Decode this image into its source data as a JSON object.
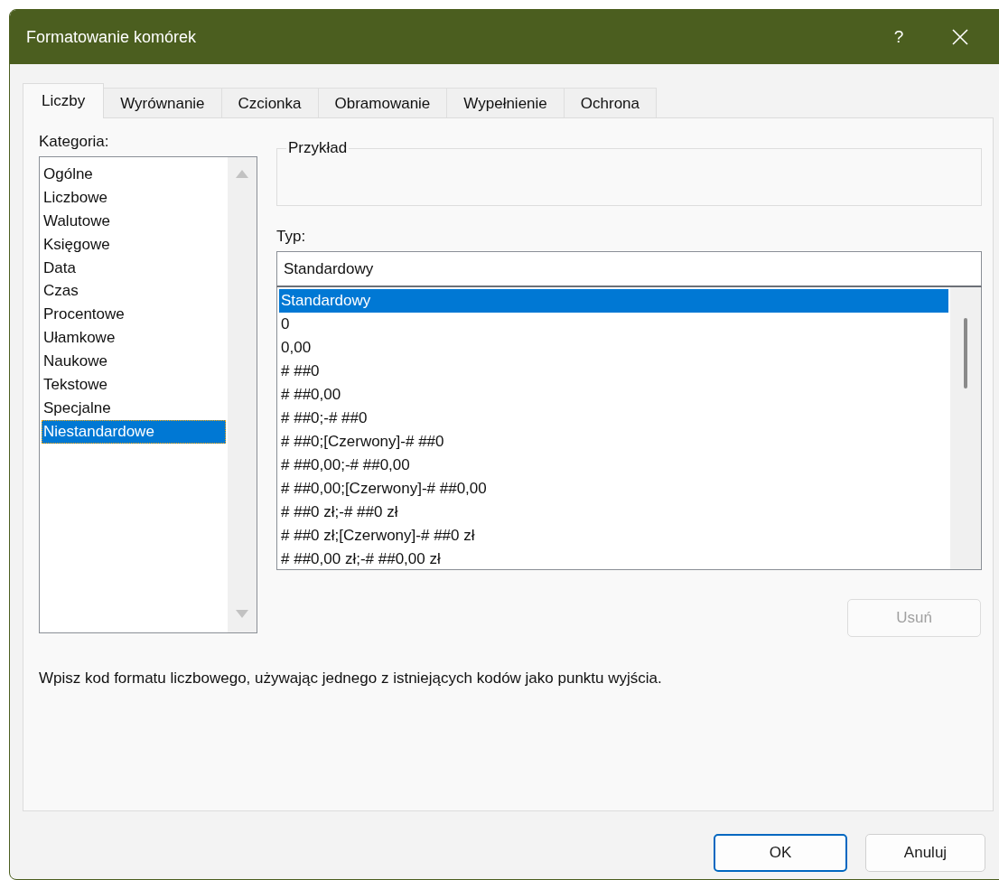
{
  "window": {
    "title": "Formatowanie komórek",
    "help_button": "?"
  },
  "tabs": [
    {
      "label": "Liczby",
      "selected": true
    },
    {
      "label": "Wyrównanie",
      "selected": false
    },
    {
      "label": "Czcionka",
      "selected": false
    },
    {
      "label": "Obramowanie",
      "selected": false
    },
    {
      "label": "Wypełnienie",
      "selected": false
    },
    {
      "label": "Ochrona",
      "selected": false
    }
  ],
  "category": {
    "label": "Kategoria:",
    "items": [
      {
        "label": "Ogólne",
        "selected": false
      },
      {
        "label": "Liczbowe",
        "selected": false
      },
      {
        "label": "Walutowe",
        "selected": false
      },
      {
        "label": "Księgowe",
        "selected": false
      },
      {
        "label": "Data",
        "selected": false
      },
      {
        "label": "Czas",
        "selected": false
      },
      {
        "label": "Procentowe",
        "selected": false
      },
      {
        "label": "Ułamkowe",
        "selected": false
      },
      {
        "label": "Naukowe",
        "selected": false
      },
      {
        "label": "Tekstowe",
        "selected": false
      },
      {
        "label": "Specjalne",
        "selected": false
      },
      {
        "label": "Niestandardowe",
        "selected": true
      }
    ]
  },
  "sample": {
    "label": "Przykład"
  },
  "type": {
    "label": "Typ:",
    "value": "Standardowy",
    "items": [
      {
        "label": "Standardowy",
        "selected": true
      },
      {
        "label": "0",
        "selected": false
      },
      {
        "label": "0,00",
        "selected": false
      },
      {
        "label": "# ##0",
        "selected": false
      },
      {
        "label": "# ##0,00",
        "selected": false
      },
      {
        "label": "# ##0;-# ##0",
        "selected": false
      },
      {
        "label": "# ##0;[Czerwony]-# ##0",
        "selected": false
      },
      {
        "label": "# ##0,00;-# ##0,00",
        "selected": false
      },
      {
        "label": "# ##0,00;[Czerwony]-# ##0,00",
        "selected": false
      },
      {
        "label": "# ##0 zł;-# ##0 zł",
        "selected": false
      },
      {
        "label": "# ##0 zł;[Czerwony]-# ##0 zł",
        "selected": false
      },
      {
        "label": "# ##0,00 zł;-# ##0,00 zł",
        "selected": false
      }
    ]
  },
  "delete_button": {
    "label": "Usuń",
    "disabled": true
  },
  "description": "Wpisz kod formatu liczbowego, używając jednego z istniejących kodów jako punktu wyjścia.",
  "buttons": [
    {
      "label": "OK",
      "default": true
    },
    {
      "label": "Anuluj",
      "default": false
    }
  ]
}
